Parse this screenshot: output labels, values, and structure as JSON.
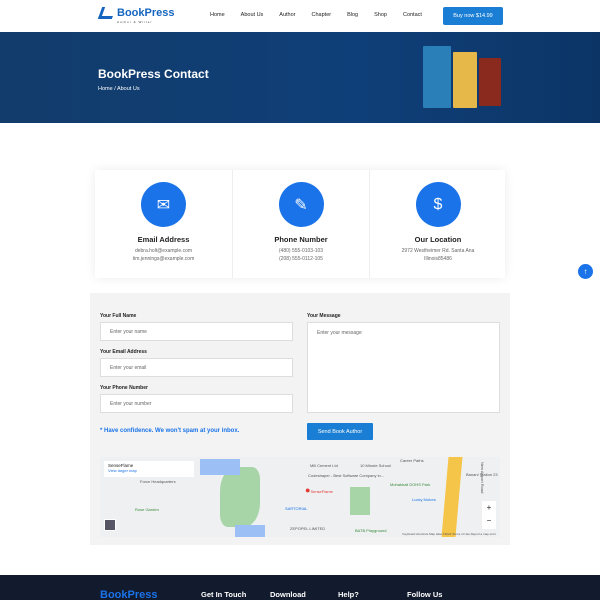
{
  "nav": {
    "logo": "BookPress",
    "logo_sub": "Author & Writer",
    "items": [
      "Home",
      "About Us",
      "Author",
      "Chapter",
      "Blog",
      "Shop",
      "Contact"
    ],
    "buy": "Buy now $14.99"
  },
  "hero": {
    "title": "BookPress Contact",
    "breadcrumb": "Home / About Us"
  },
  "cards": [
    {
      "title": "Email Address",
      "lines": [
        "debra.holt@example.com",
        "tim.jennings@example.com"
      ]
    },
    {
      "title": "Phone Number",
      "lines": [
        "(480) 555-0103-103",
        "(208) 555-0112-105"
      ]
    },
    {
      "title": "Our Location",
      "lines": [
        "2972 Westheimer Rd. Santa Ana",
        "Illinois85486"
      ]
    }
  ],
  "form": {
    "name_label": "Your Full Name",
    "name_ph": "Enter your name",
    "email_label": "Your Email Address",
    "email_ph": "Enter your email",
    "phone_label": "Your Phone Number",
    "phone_ph": "Enter your number",
    "msg_label": "Your Message",
    "msg_ph": "Enter your message",
    "note": "* Have confidence. We won't spam at your inbox.",
    "send": "Send Book Author"
  },
  "map": {
    "place": "SenseFlame",
    "link": "View larger map",
    "marker": "SenseFlame",
    "labels": [
      "Codeshaper - Best Software Company in...",
      "Rose Garden",
      "Mohakhali DOHS Park",
      "Lucky Motors",
      "BATB Playground",
      "New Airport Road",
      "SARTORIAL",
      "ZEPOPEL LIMITED",
      "Force Headquarters",
      "Mill Cement Ltd",
      "10 Minute School",
      "Career Paths",
      "Banani Station 23"
    ],
    "zoom_in": "+",
    "zoom_out": "−",
    "footer": "Keyboard shortcuts   Map data ©2022   Terms of Use   Report a map error"
  },
  "footer": {
    "logo": "BookPress",
    "cols": [
      "Get In Touch",
      "Download",
      "Help?",
      "Follow Us"
    ]
  }
}
